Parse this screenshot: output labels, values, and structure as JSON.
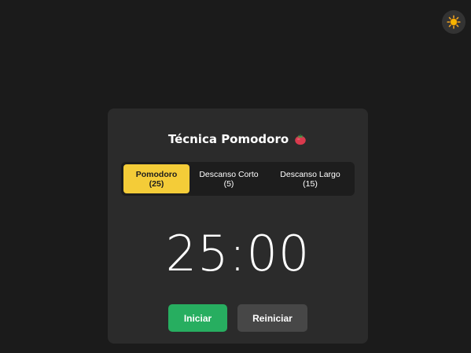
{
  "header": {
    "theme_toggle_icon": "sun-icon"
  },
  "card": {
    "title": "Técnica Pomodoro",
    "title_icon": "tomato-icon"
  },
  "modes": [
    {
      "name": "Pomodoro",
      "minutes": "(25)",
      "active": true
    },
    {
      "name": "Descanso Corto",
      "minutes": "(5)",
      "active": false
    },
    {
      "name": "Descanso Largo",
      "minutes": "(15)",
      "active": false
    }
  ],
  "timer": {
    "display": "25:00"
  },
  "controls": {
    "start_label": "Iniciar",
    "reset_label": "Reiniciar"
  },
  "colors": {
    "background": "#1b1b1b",
    "card": "#2b2b2b",
    "active_tab": "#f4cc38",
    "start_button": "#27ae60",
    "reset_button": "#474747"
  }
}
